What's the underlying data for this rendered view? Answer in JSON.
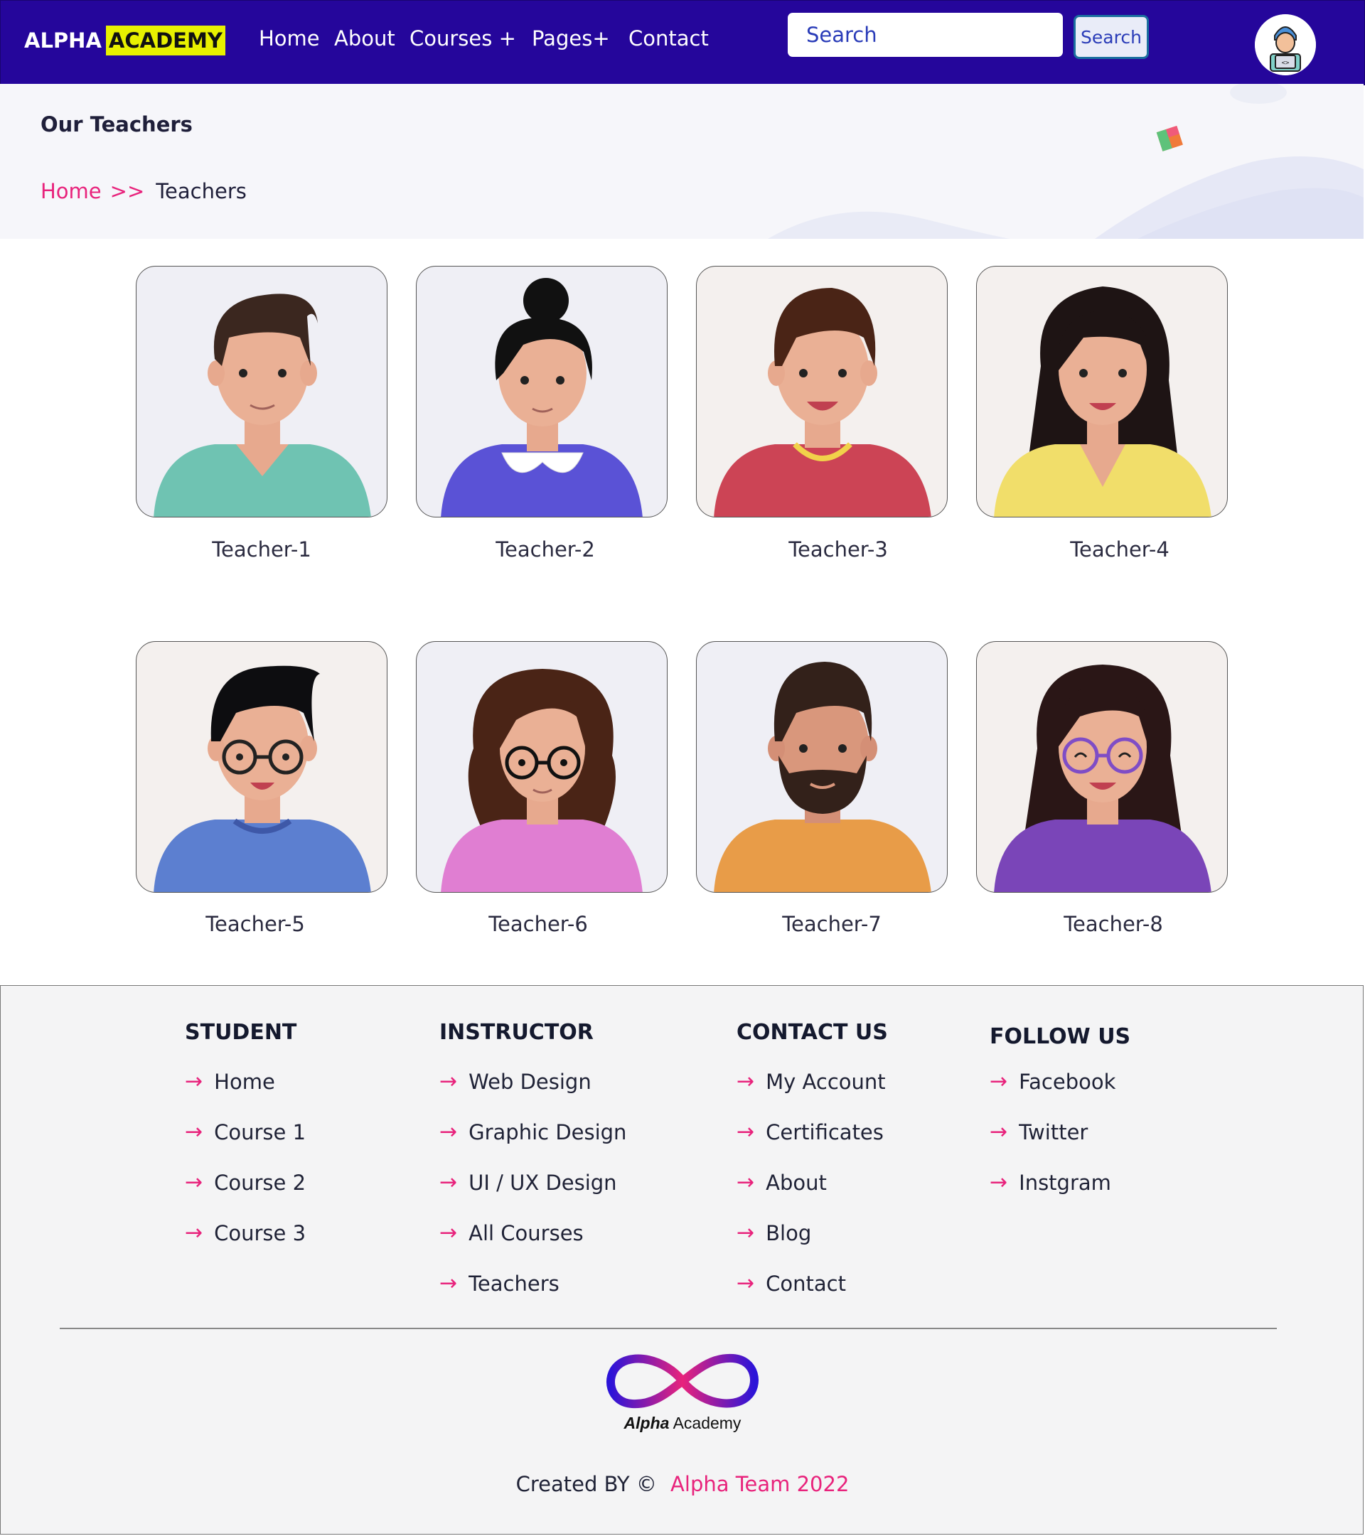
{
  "nav": {
    "brand_part1": "ALPHA",
    "brand_part2": "ACADEMY",
    "links": [
      "Home",
      "About",
      "Courses +",
      "Pages+",
      "Contact"
    ],
    "search_placeholder": "Search",
    "search_button": "Search"
  },
  "banner": {
    "title": "Our Teachers",
    "breadcrumb_home": "Home",
    "breadcrumb_sep": ">>",
    "breadcrumb_current": "Teachers"
  },
  "teachers": [
    "Teacher-1",
    "Teacher-2",
    "Teacher-3",
    "Teacher-4",
    "Teacher-5",
    "Teacher-6",
    "Teacher-7",
    "Teacher-8"
  ],
  "footer": {
    "student": {
      "heading": "STUDENT",
      "items": [
        "Home",
        "Course 1",
        "Course 2",
        "Course 3"
      ]
    },
    "instructor": {
      "heading": "INSTRUCTOR",
      "items": [
        "Web Design",
        "Graphic Design",
        "UI / UX Design",
        "All Courses",
        "Teachers"
      ]
    },
    "contact": {
      "heading": "CONTACT US",
      "items": [
        "My Account",
        "Certificates",
        "About",
        "Blog",
        "Contact"
      ]
    },
    "follow": {
      "heading": "FOLLOW US",
      "items": [
        "Facebook",
        "Twitter",
        "Instgram"
      ]
    },
    "logo_word1": "Alpha",
    "logo_word2": "Academy",
    "created_by": "Created BY ©",
    "team": "Alpha Team 2022"
  },
  "colors": {
    "navbar": "#25069b",
    "accent_pink": "#e8237c",
    "brand_highlight": "#e8f000"
  }
}
